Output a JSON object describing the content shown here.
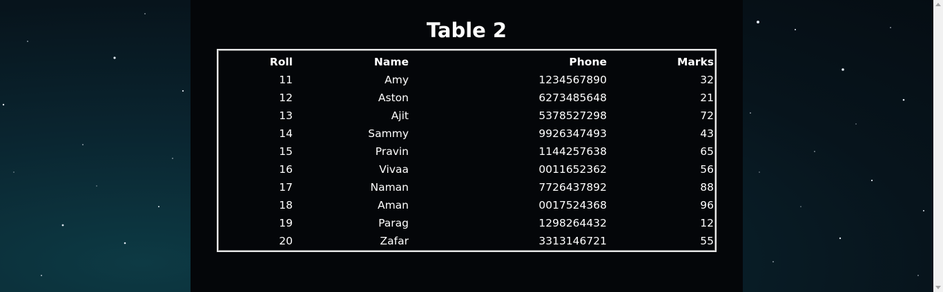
{
  "page": {
    "title": "Table 2"
  },
  "table": {
    "headers": [
      "Roll",
      "Name",
      "Phone",
      "Marks"
    ],
    "rows": [
      [
        "11",
        "Amy",
        "1234567890",
        "32"
      ],
      [
        "12",
        "Aston",
        "6273485648",
        "21"
      ],
      [
        "13",
        "Ajit",
        "5378527298",
        "72"
      ],
      [
        "14",
        "Sammy",
        "9926347493",
        "43"
      ],
      [
        "15",
        "Pravin",
        "1144257638",
        "65"
      ],
      [
        "16",
        "Vivaa",
        "0011652362",
        "56"
      ],
      [
        "17",
        "Naman",
        "7726437892",
        "88"
      ],
      [
        "18",
        "Aman",
        "0017524368",
        "96"
      ],
      [
        "19",
        "Parag",
        "1298264432",
        "12"
      ],
      [
        "20",
        "Zafar",
        "3313146721",
        "55"
      ]
    ]
  },
  "theme": {
    "background": "#07141c",
    "panel": "#040609",
    "text": "#ffffff",
    "border": "#e6e6e6"
  },
  "scrollbar": {
    "up_icon": "scroll-up-arrow-icon",
    "down_icon": "scroll-down-arrow-icon"
  }
}
